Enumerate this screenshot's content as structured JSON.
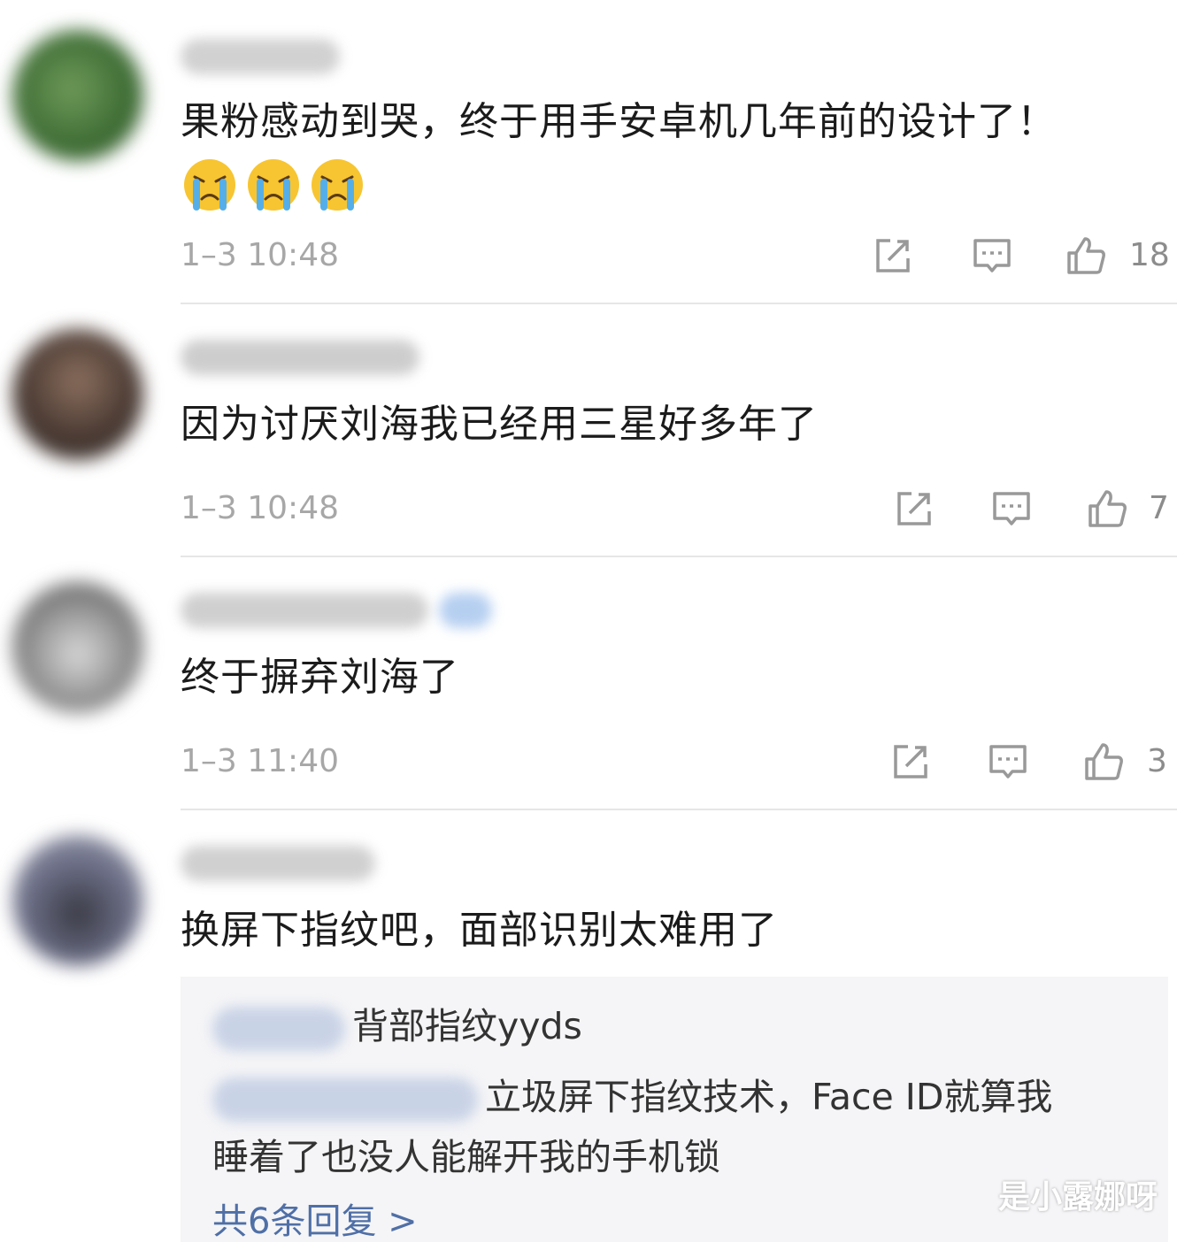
{
  "comments": [
    {
      "text": "果粉感动到哭，终于用手安卓机几年前的设计了！",
      "emojis": [
        "crying-face-emoji",
        "crying-face-emoji",
        "crying-face-emoji"
      ],
      "time": "1–3 10:48",
      "likes": "18"
    },
    {
      "text": "因为讨厌刘海我已经用三星好多年了",
      "time": "1–3 10:48",
      "likes": "7"
    },
    {
      "text": "终于摒弃刘海了",
      "time": "1–3 11:40",
      "likes": "3"
    },
    {
      "text": "换屏下指纹吧，面部识别太难用了",
      "replies": [
        {
          "text": "背部指纹yyds"
        },
        {
          "text": "立圾屏下指纹技术，Face ID就算我",
          "text_cont": "睡着了也没人能解开我的手机锁"
        }
      ],
      "more_replies": "共6条回复 >"
    }
  ],
  "watermark": "是小露娜呀",
  "colors": {
    "time": "#a7a7a7",
    "link": "#4f6fa6",
    "reply_bg": "#f5f5f7",
    "divider": "#e6e6e6"
  }
}
